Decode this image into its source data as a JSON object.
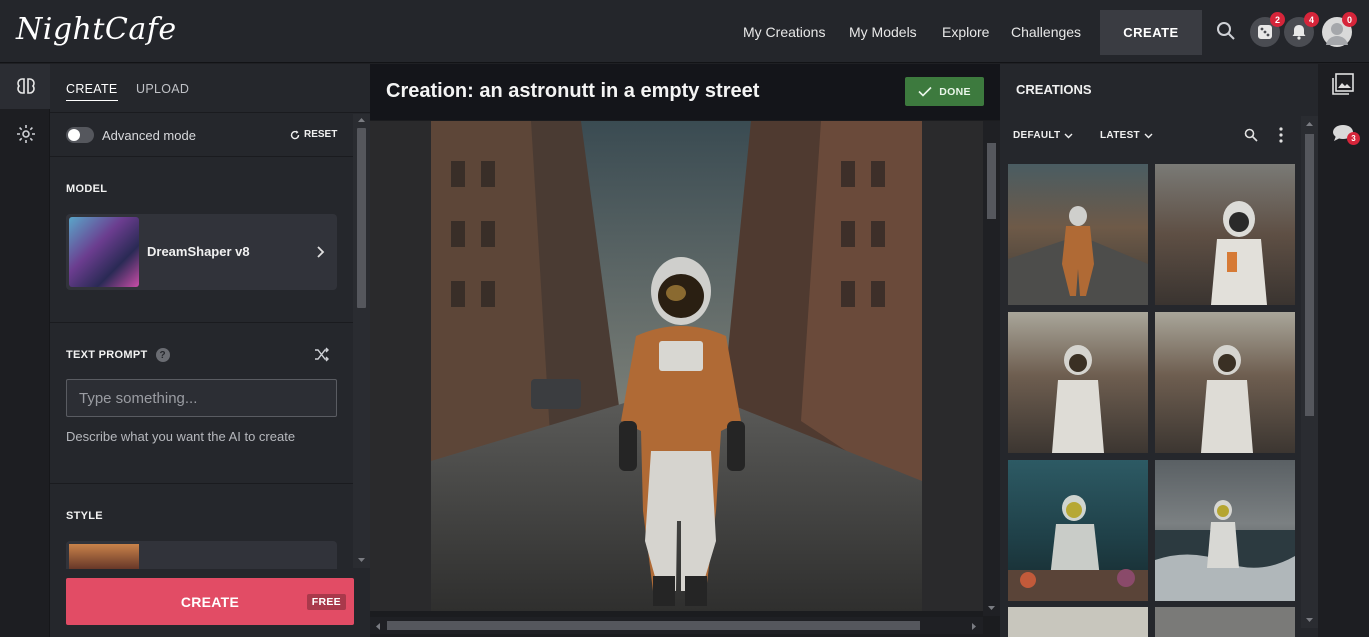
{
  "app": {
    "logo": "NightCafe"
  },
  "nav": {
    "items": [
      "My Creations",
      "My Models",
      "Explore",
      "Challenges"
    ],
    "create_label": "CREATE",
    "dice_badge": "2",
    "bell_badge": "4",
    "avatar_badge": "0"
  },
  "left": {
    "tabs": [
      "CREATE",
      "UPLOAD"
    ],
    "advanced_label": "Advanced mode",
    "reset_label": "RESET",
    "model_heading": "MODEL",
    "model_name": "DreamShaper v8",
    "prompt_heading": "TEXT PROMPT",
    "prompt_help": "?",
    "prompt_placeholder": "Type something...",
    "prompt_hint": "Describe what you want the AI to create",
    "style_heading": "STYLE",
    "create_label": "CREATE",
    "free_label": "FREE"
  },
  "center": {
    "title": "Creation: an astronutt in a empty street",
    "done_label": "DONE"
  },
  "right": {
    "heading": "CREATIONS",
    "sort_default": "DEFAULT",
    "sort_latest": "LATEST"
  },
  "rightrail": {
    "chat_badge": "3"
  },
  "colors": {
    "accent_create": "#e24c65",
    "done_green": "#3d7a3e",
    "badge_red": "#d6253a"
  }
}
